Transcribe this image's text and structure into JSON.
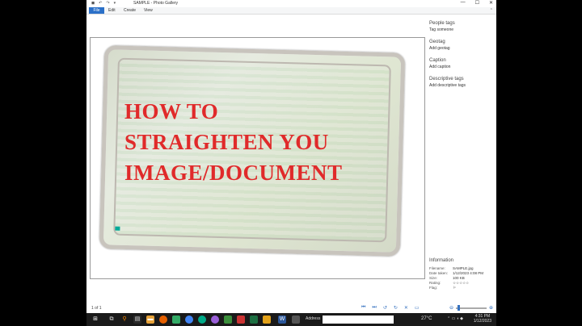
{
  "window": {
    "title": "SAMPLE - Photo Gallery",
    "min": "—",
    "max": "☐",
    "close": "✕"
  },
  "quick_access": [
    "◼",
    "↶",
    "↷",
    "▾"
  ],
  "ribbon": {
    "tabs": [
      "File",
      "Edit",
      "Create",
      "View"
    ],
    "collapse": "⌃"
  },
  "image_text": {
    "line1": "HOW TO",
    "line2": "STRAIGHTEN YOU",
    "line3": "IMAGE/DOCUMENT"
  },
  "sidebar": {
    "people_tags": {
      "heading": "People tags",
      "action": "Tag someone"
    },
    "geotag": {
      "heading": "Geotag",
      "action": "Add geotag"
    },
    "caption": {
      "heading": "Caption",
      "action": "Add caption"
    },
    "descriptive_tags": {
      "heading": "Descriptive tags",
      "action": "Add descriptive tags"
    }
  },
  "information": {
    "heading": "Information",
    "rows": [
      {
        "key": "Filename:",
        "value": "SAMPLE.jpg"
      },
      {
        "key": "Date taken:",
        "value": "1/12/2023   4:08 PM"
      },
      {
        "key": "Size:",
        "value": "100 KB"
      },
      {
        "key": "Rating:",
        "value": "☆☆☆☆☆"
      },
      {
        "key": "Flag:",
        "value": "⚐"
      }
    ]
  },
  "status": {
    "count": "1 of 1"
  },
  "taskbar": {
    "address_label": "Address",
    "weather": "27°C",
    "time": "4:31 PM",
    "date": "1/12/2023"
  },
  "colors": {
    "accent": "#2b70c8",
    "overlay_text": "#e02a2a",
    "taskbar": "#1a1a1a"
  }
}
